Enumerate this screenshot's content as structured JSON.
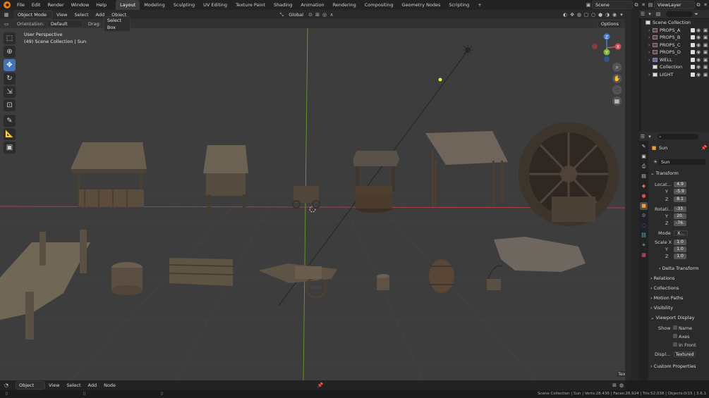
{
  "menu": [
    "File",
    "Edit",
    "Render",
    "Window",
    "Help"
  ],
  "workspaces": [
    "Layout",
    "Modeling",
    "Sculpting",
    "UV Editing",
    "Texture Paint",
    "Shading",
    "Animation",
    "Rendering",
    "Compositing",
    "Geometry Nodes",
    "Scripting"
  ],
  "active_workspace": "Layout",
  "scene_name": "Scene",
  "view_layer": "ViewLayer",
  "viewport": {
    "mode": "Object Mode",
    "menus": [
      "View",
      "Select",
      "Add",
      "Object"
    ],
    "transform_orientation": "Global",
    "orientation_label": "Orientation:",
    "orientation_value": "Default",
    "drag_label": "Drag:",
    "drag_value": "Select Box",
    "options": "Options",
    "overlay_title": "User Perspective",
    "overlay_sub": "(49) Scene Collection | Sun",
    "text_tab": "Tex",
    "gizmo": {
      "z": "Z",
      "y": "Y",
      "x": "X"
    }
  },
  "outliner": {
    "root": "Scene Collection",
    "items": [
      "PROPS_A",
      "PROPS_B",
      "PROPS_C",
      "PROPS_D",
      "WELL",
      "Collection",
      "LIGHT"
    ]
  },
  "properties": {
    "object_name": "Sun",
    "data_name": "Sun",
    "transform": "Transform",
    "location_label": "Locat...",
    "location": [
      "4.9",
      "-5.9",
      "8.1"
    ],
    "rotation_label": "Rotati...",
    "rotation": [
      "-33.",
      "20.",
      "-76."
    ],
    "mode_label": "Mode",
    "mode_value": "X...",
    "scale_label": "Scale X",
    "scale": [
      "1.0",
      "1.0",
      "1.0"
    ],
    "y": "Y",
    "z": "Z",
    "delta": "Delta Transform",
    "sections": [
      "Relations",
      "Collections",
      "Motion Paths",
      "Visibility"
    ],
    "viewport_display": "Viewport Display",
    "show_label": "Show",
    "show_name": "Name",
    "show_axes": "Axes",
    "show_infront": "In Front",
    "display_label": "Displ...",
    "display_value": "Textured",
    "custom": "Custom Properties"
  },
  "footer": {
    "mode": "Object",
    "menus": [
      "View",
      "Select",
      "Add",
      "Node"
    ]
  },
  "status": "Scene Collection | Sun | Verts:28,436 | Faces:26,924 | Tris:52,038 | Objects:0/15 | 3.6.1"
}
